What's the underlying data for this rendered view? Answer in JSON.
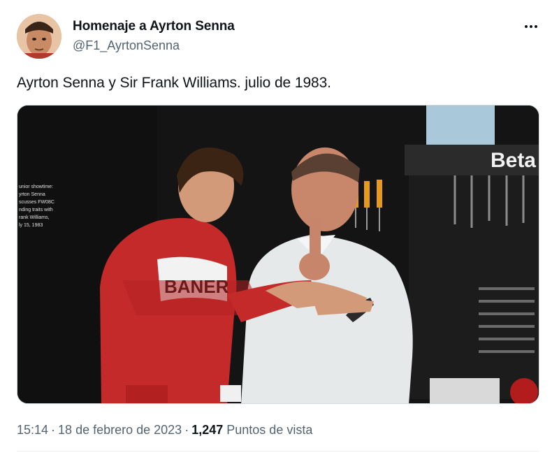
{
  "author": {
    "display_name": "Homenaje a Ayrton Senna",
    "handle": "@F1_AyrtonSenna"
  },
  "tweet": {
    "text": "Ayrton Senna y Sir Frank Williams. julio de 1983."
  },
  "media": {
    "caption_lines": [
      "unior showtime:",
      "yrton Senna",
      "scusses FW08C",
      "nding traits with",
      "rank Williams,",
      "ly 15, 1983"
    ],
    "sign_text": "Beta",
    "jacket_text": "BANER"
  },
  "meta": {
    "time": "15:14",
    "separator": "·",
    "date": "18 de febrero de 2023",
    "views_count": "1,247",
    "views_label": "Puntos de vista"
  },
  "icons": {
    "more": "more-horizontal-icon"
  }
}
